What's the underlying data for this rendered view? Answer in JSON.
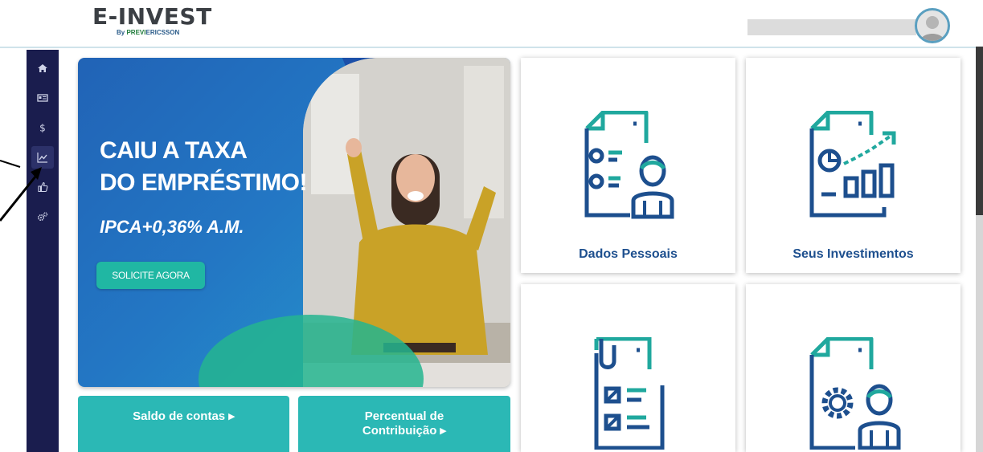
{
  "header": {
    "logo_main": "E-INVEST",
    "logo_by": "By",
    "logo_brand_a": "PREVI",
    "logo_brand_b": "ERICSSON"
  },
  "sidebar": {
    "items": [
      {
        "icon": "home-icon"
      },
      {
        "icon": "id-card-icon"
      },
      {
        "icon": "dollar-icon"
      },
      {
        "icon": "chart-line-icon"
      },
      {
        "icon": "thumbs-up-icon"
      },
      {
        "icon": "settings-icon"
      }
    ]
  },
  "banner": {
    "title_line1": "CAIU A TAXA",
    "title_line2": "DO EMPRÉSTIMO!",
    "rate": "IPCA+0,36% A.M.",
    "cta": "SOLICITE AGORA"
  },
  "actions": {
    "saldo": "Saldo de contas ▸",
    "percentual_line1": "Percentual de",
    "percentual_line2": "Contribuição ▸"
  },
  "cards": [
    {
      "label": "Dados Pessoais",
      "icon": "personal-data-icon"
    },
    {
      "label": "Seus Investimentos",
      "icon": "investments-icon"
    },
    {
      "label": "",
      "icon": "checklist-icon"
    },
    {
      "label": "",
      "icon": "settings-user-icon"
    }
  ],
  "colors": {
    "sidebar": "#1a1d4e",
    "teal": "#2bb8b5",
    "icon_primary": "#1d4f8e",
    "icon_accent": "#20a89e"
  }
}
